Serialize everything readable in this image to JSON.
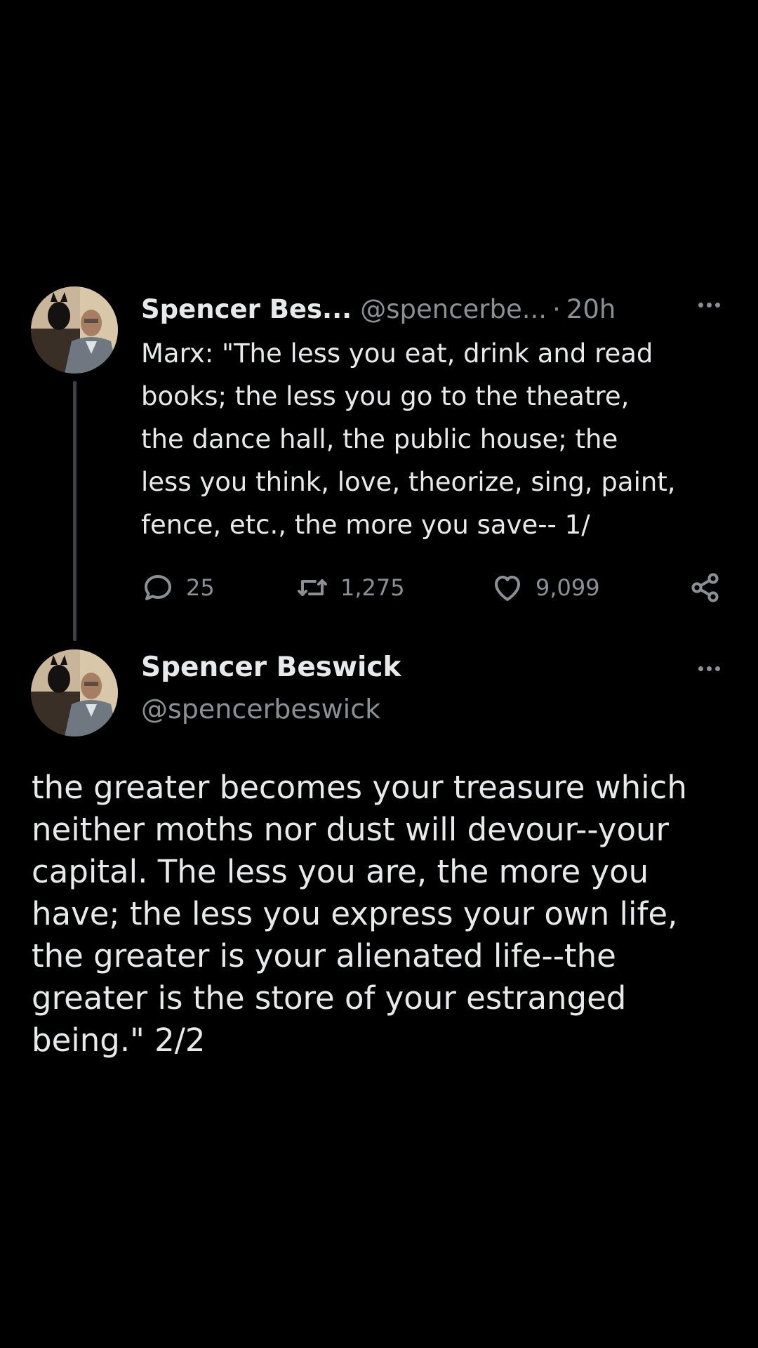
{
  "tweet1": {
    "author_name": "Spencer Bes...",
    "handle": "@spencerbe...",
    "separator": "·",
    "time": "20h",
    "more_icon": "more-horizontal-icon",
    "text_lines": [
      "Marx: \"The less you eat, drink and read",
      "books; the less you go to the theatre,",
      "the dance hall, the public house; the",
      "less you think, love, theorize, sing, paint,",
      "fence, etc., the more you save-- 1/"
    ],
    "actions": {
      "reply_count": "25",
      "retweet_count": "1,275",
      "like_count": "9,099",
      "reply_icon": "reply-icon",
      "retweet_icon": "retweet-icon",
      "like_icon": "heart-icon",
      "share_icon": "share-icon"
    }
  },
  "tweet2": {
    "author_name": "Spencer Beswick",
    "handle": "@spencerbeswick",
    "more_icon": "more-horizontal-icon",
    "text_lines": [
      "the greater becomes your treasure which",
      "neither moths nor dust will devour--your",
      "capital. The less you are, the more you",
      "have; the less you express your own life,",
      "the greater is your alienated life--the",
      "greater is the store of your estranged",
      "being.\" 2/2"
    ]
  },
  "colors": {
    "background": "#000000",
    "primary_text": "#e7e9ea",
    "secondary_text": "#8b9095",
    "thread_line": "#3e4144"
  }
}
